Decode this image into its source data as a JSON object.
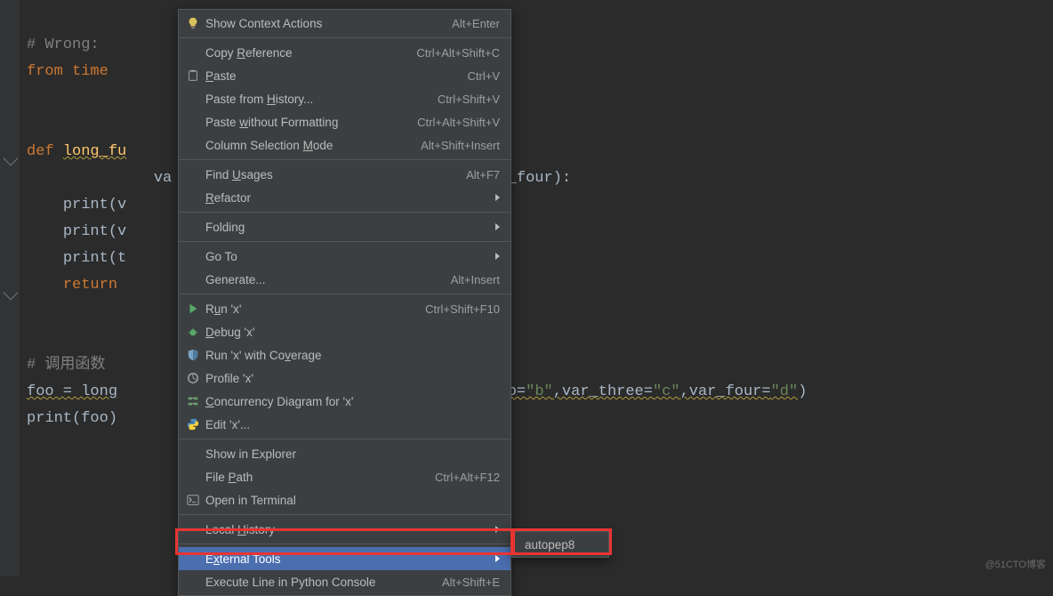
{
  "code": {
    "line1_comment": "# Wrong:",
    "line2_from": "from",
    "line2_time": "time",
    "line3_def": "def",
    "line3_fn": "long_fu",
    "line4_var": "va",
    "line4_after": "r_four):",
    "line5": "print(v",
    "line6": "print(v",
    "line7": "print(t",
    "line8": "return",
    "line9_comment": "# 调用函数",
    "line10_foo": "foo = long",
    "line10_rest_kw1": ",var_two=",
    "line10_rest_s1": "\"b\"",
    "line10_rest_kw2": ",var_three=",
    "line10_rest_s2": "\"c\"",
    "line10_rest_kw3": ",var_four=",
    "line10_rest_s3": "\"d\"",
    "line10_paren": ")",
    "line11": "print(foo)"
  },
  "menu": {
    "items": [
      {
        "icon": "bulb",
        "label": "Show Context Actions",
        "shortcut": "Alt+Enter"
      },
      {
        "sep": true
      },
      {
        "label": "Copy Reference",
        "u": 5,
        "shortcut": "Ctrl+Alt+Shift+C"
      },
      {
        "icon": "clipboard",
        "label": "Paste",
        "u": 0,
        "shortcut": "Ctrl+V"
      },
      {
        "label": "Paste from History...",
        "u": 11,
        "shortcut": "Ctrl+Shift+V"
      },
      {
        "label": "Paste without Formatting",
        "u": 6,
        "shortcut": "Ctrl+Alt+Shift+V"
      },
      {
        "label": "Column Selection Mode",
        "u": 17,
        "shortcut": "Alt+Shift+Insert"
      },
      {
        "sep": true
      },
      {
        "label": "Find Usages",
        "u": 5,
        "shortcut": "Alt+F7"
      },
      {
        "label": "Refactor",
        "u": 0,
        "arrow": true
      },
      {
        "sep": true
      },
      {
        "label": "Folding",
        "arrow": true
      },
      {
        "sep": true
      },
      {
        "label": "Go To",
        "arrow": true
      },
      {
        "label": "Generate...",
        "shortcut": "Alt+Insert"
      },
      {
        "sep": true
      },
      {
        "icon": "play",
        "label": "Run 'x'",
        "u": 1,
        "shortcut": "Ctrl+Shift+F10"
      },
      {
        "icon": "bug",
        "label": "Debug 'x'",
        "u": 0
      },
      {
        "icon": "coverage",
        "label": "Run 'x' with Coverage",
        "u": 15
      },
      {
        "icon": "profile",
        "label": "Profile 'x'"
      },
      {
        "icon": "concurrency",
        "label": "Concurrency Diagram for 'x'",
        "u": 0
      },
      {
        "icon": "python",
        "label": "Edit 'x'..."
      },
      {
        "sep": true
      },
      {
        "label": "Show in Explorer"
      },
      {
        "label": "File Path",
        "u": 5,
        "shortcut": "Ctrl+Alt+F12"
      },
      {
        "icon": "terminal",
        "label": "Open in Terminal"
      },
      {
        "sep": true
      },
      {
        "label": "Local History",
        "u": 6,
        "arrow": true
      },
      {
        "sep": true
      },
      {
        "label": "External Tools",
        "u": 1,
        "arrow": true,
        "highlight": true
      },
      {
        "label": "Execute Line in Python Console",
        "shortcut": "Alt+Shift+E"
      }
    ]
  },
  "submenu": {
    "label": "autopep8"
  },
  "watermark": "@51CTO博客"
}
